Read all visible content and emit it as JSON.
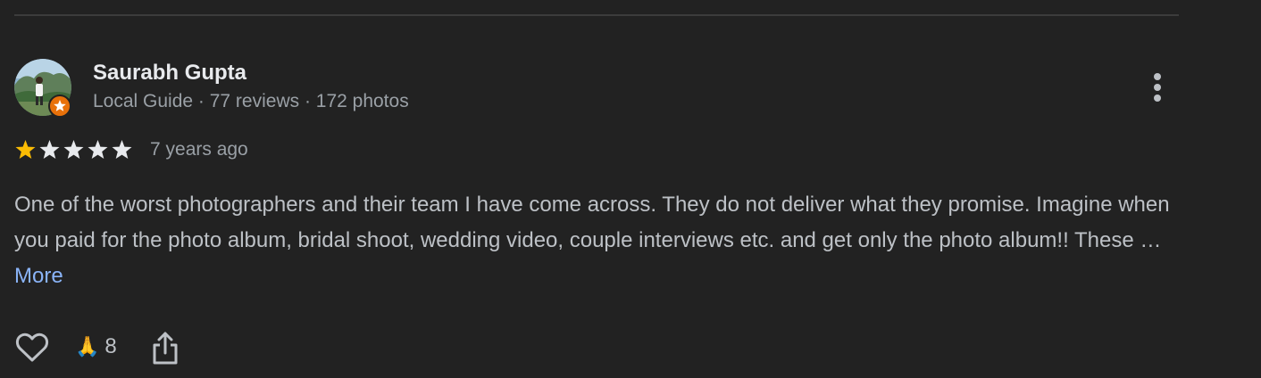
{
  "reviewer": {
    "name": "Saurabh Gupta",
    "meta": "Local Guide · 77 reviews · 172 photos"
  },
  "rating": {
    "value": 1,
    "max": 5,
    "time": "7 years ago"
  },
  "review": {
    "text": "One of the worst photographers and their team I have come across. They do not deliver what they promise. Imagine when you paid for the photo album, bridal shoot, wedding video, couple interviews etc. and get only the photo album!! These … ",
    "more_label": "More"
  },
  "actions": {
    "reaction_emoji": "🙏",
    "reaction_count": "8"
  },
  "colors": {
    "background": "#222222",
    "star_filled": "#fbbc04",
    "star_empty": "#e8eaed",
    "link": "#8ab4f8",
    "guide_badge": "#e8710a"
  },
  "icons": {
    "menu": "more-vert-icon",
    "like": "heart-outline-icon",
    "share": "share-icon"
  }
}
